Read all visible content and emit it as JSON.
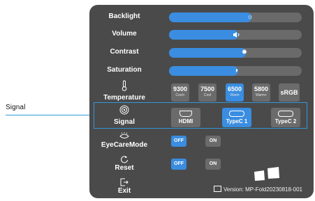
{
  "callout": {
    "label": "Signal"
  },
  "menu": {
    "backlight": {
      "label": "Backlight",
      "level": 0.62
    },
    "volume": {
      "label": "Volume",
      "level": 0.52
    },
    "contrast": {
      "label": "Contrast",
      "level": 0.58
    },
    "saturation": {
      "label": "Saturation",
      "level": 0.52
    },
    "temperature": {
      "label": "Temperature",
      "options": [
        {
          "value": "9300",
          "sub": "Cool+"
        },
        {
          "value": "7500",
          "sub": "Cool"
        },
        {
          "value": "6500",
          "sub": "Warm"
        },
        {
          "value": "5800",
          "sub": "Warm+"
        }
      ],
      "selected": "6500",
      "srgb_label": "sRGB"
    },
    "signal": {
      "label": "Signal",
      "options": [
        "HDMI",
        "TypeC 1",
        "TypeC 2"
      ],
      "selected": "TypeC 1"
    },
    "eyecare": {
      "label": "EyeCareMode",
      "off": "OFF",
      "on": "ON",
      "selected": "OFF"
    },
    "reset": {
      "label": "Reset",
      "off": "OFF",
      "on": "ON",
      "selected": "OFF"
    },
    "exit": {
      "label": "Exit"
    },
    "version": "Version: MP-Fold20230818-001"
  },
  "colors": {
    "accent": "#3a8de0",
    "panel": "#4a4a4a",
    "callout_line": "#2b9bd2"
  },
  "icons": {
    "backlight": "sun-icon",
    "volume": "speaker-icon",
    "contrast": "contrast-sun-icon",
    "saturation": "saturation-icon",
    "temperature": "thermometer-icon",
    "signal": "signal-icon",
    "eyecare": "eye-icon",
    "reset": "reset-icon",
    "exit": "exit-icon"
  }
}
